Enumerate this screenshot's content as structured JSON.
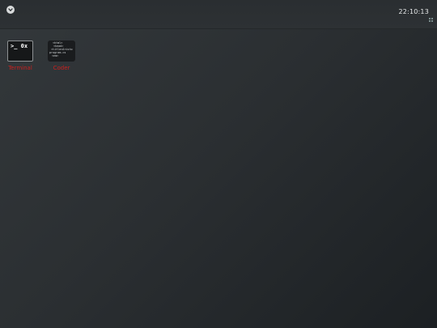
{
  "topbar": {
    "menu_icon": "chevron-down-circle-icon",
    "clock": "22:10:13",
    "grip_icon": "grip-dots-icon"
  },
  "desktop": {
    "icons": [
      {
        "label": "Terminal",
        "glyph": ">_ 0x",
        "icon": "terminal-icon"
      },
      {
        "label": "Coder",
        "icon": "code-editor-icon",
        "code_lines": [
          "<html>",
          "<head>",
          "<title>Aristo",
          "program.cs",
          "<em>"
        ]
      }
    ]
  },
  "colors": {
    "label_color": "#c9201e",
    "clock_color": "#e6e8e9",
    "background": "#2b2f32"
  }
}
